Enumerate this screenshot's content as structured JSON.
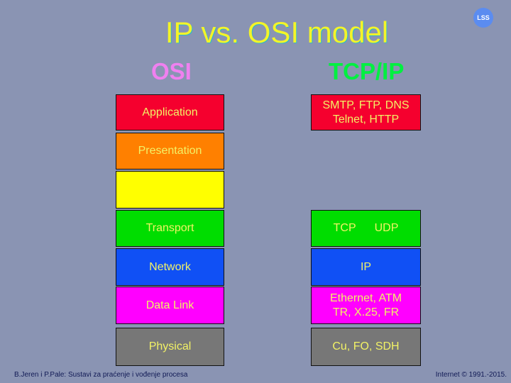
{
  "title": "IP vs. OSI model",
  "logo": "LSS",
  "columns": {
    "osi": "OSI",
    "tcpip": "TCP/IP"
  },
  "colors": {
    "background": "#8a94b3",
    "application": "#f5002e",
    "presentation": "#ff8000",
    "session": "#ffff00",
    "transport": "#00dd00",
    "network": "#1050f5",
    "datalink": "#ff00ff",
    "physical": "#777777",
    "osi_heading": "#f080f0",
    "tcpip_heading": "#00f040"
  },
  "osi_layers": [
    "Application",
    "Presentation",
    "",
    "Transport",
    "Network",
    "Data Link",
    "Physical"
  ],
  "tcpip": {
    "application_line1": "SMTP, FTP, DNS",
    "application_line2": "Telnet, HTTP",
    "tcp": "TCP",
    "udp": "UDP",
    "ip": "IP",
    "datalink_line1": "Ethernet, ATM",
    "datalink_line2": "TR, X.25, FR",
    "physical": "Cu, FO, SDH"
  },
  "footer": {
    "left": "B.Jeren i P.Pale: Sustavi za praćenje i vođenje procesa",
    "right": "Internet © 1991.-2015."
  }
}
